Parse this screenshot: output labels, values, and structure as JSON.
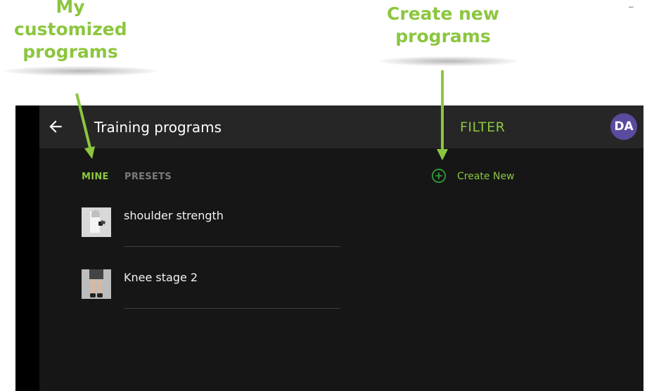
{
  "annotations": {
    "mine_callout": "My customized programs",
    "create_callout": "Create new programs",
    "accent": "#8cc63f",
    "corner_mark": "–"
  },
  "appbar": {
    "back_icon": "arrow-left-icon",
    "title": "Training programs",
    "filter_label": "FILTER",
    "avatar_initials": "DA",
    "avatar_color": "#5b4a9e"
  },
  "tabs": {
    "mine": "MINE",
    "presets": "PRESETS",
    "active": "MINE"
  },
  "create_new": {
    "icon": "plus-circle-icon",
    "label": "Create New"
  },
  "programs": [
    {
      "name": "shoulder strength",
      "thumbnail": "shoulder-exercise-thumbnail"
    },
    {
      "name": "Knee stage 2",
      "thumbnail": "knee-exercise-thumbnail"
    }
  ]
}
